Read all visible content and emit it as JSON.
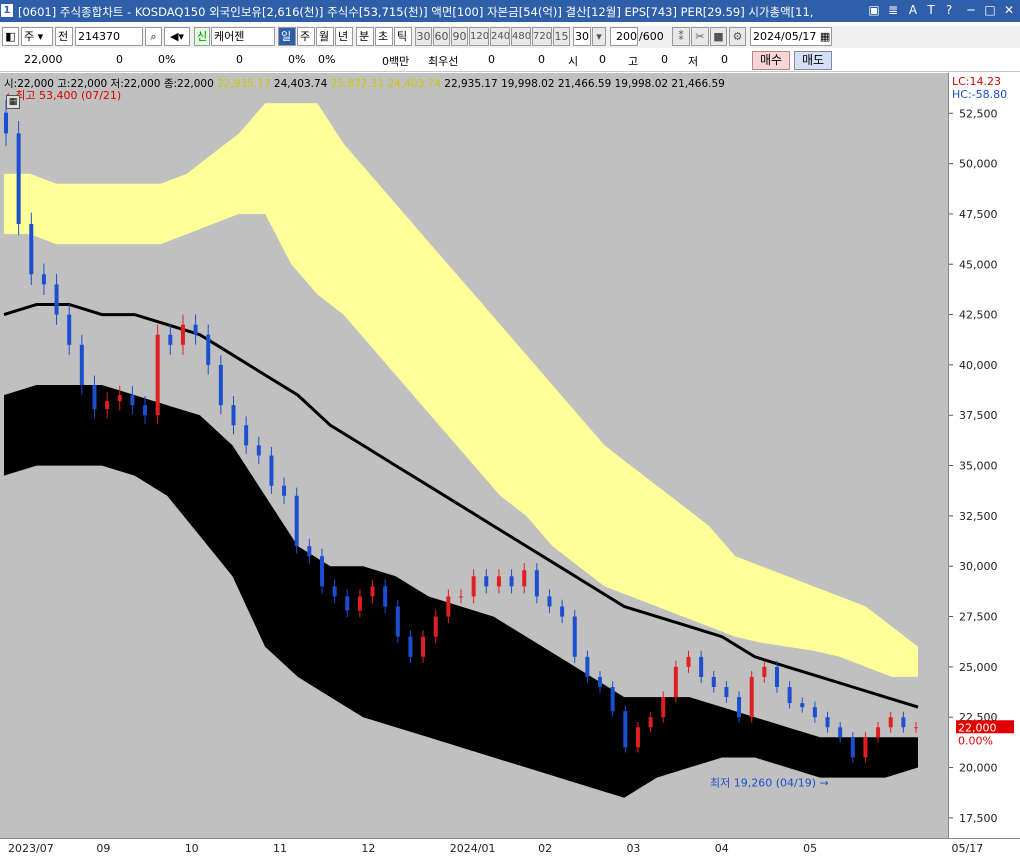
{
  "window": {
    "index_badge": "1",
    "title": "[0601] 주식종합차트 - KOSDAQ150 외국인보유[2,616(천)] 주식수[53,715(천)] 액면[100] 자본금[54(억)] 결산[12월] EPS[743] PER[29.59] 시가총액[11,"
  },
  "toolbar": {
    "period_selector": "주",
    "market_selector": "전",
    "stock_code": "214370",
    "stock_name": "케어젠",
    "new_badge": "신",
    "period_tabs": [
      "일",
      "주",
      "월",
      "년",
      "분",
      "초",
      "틱"
    ],
    "selected_period": "일",
    "interval_buttons": [
      "30",
      "60",
      "90",
      "120",
      "240",
      "480",
      "720",
      "15",
      "30"
    ],
    "count_value": "200",
    "count_total": "/600",
    "date": "2024/05/17"
  },
  "infobar": {
    "price": "22,000",
    "change": "0",
    "rate": "0%",
    "volume": "0",
    "vol_rate": "0%",
    "vol_rate2": "0%",
    "amount": "0백만",
    "priority_label": "최우선",
    "priority_value": "0",
    "v2": "0",
    "open_label": "시",
    "open_value": "0",
    "high_label": "고",
    "high_value": "0",
    "low_label": "저",
    "low_value": "0",
    "buy_label": "매수",
    "sell_label": "매도"
  },
  "legend": {
    "ohlc": "시:22,000 고:22,000 저:22,000 종:22,000",
    "cloud1_a": "22,935.17",
    "cloud1_b": "24,403.74",
    "cloud2_a": "25,872.31",
    "cloud2_b": "24,403.74",
    "lines": "22,935.17 19,998.02 21,466.59 19,998.02 21,466.59"
  },
  "indicators": {
    "lc": "LC:14.23",
    "hc": "HC:-58.80"
  },
  "annotations": {
    "high": "최고 53,400 (07/21)",
    "low": "최저 19,260 (04/19)"
  },
  "current_price_tag": {
    "price": "22,000",
    "rate": "0.00%"
  },
  "colors": {
    "up": "#e02020",
    "down": "#1c4fd0",
    "cloud_yellow": "#ffff99",
    "cloud_black": "#000000",
    "chart_bg": "#c0c0c0",
    "title_bg": "#2e5fa8"
  },
  "chart_data": {
    "type": "candlestick",
    "title": "",
    "y_axis": {
      "range": [
        16500,
        54500
      ],
      "ticks": [
        52500,
        50000,
        47500,
        45000,
        42500,
        40000,
        37500,
        35000,
        32500,
        30000,
        27500,
        25000,
        22500,
        20000,
        17500
      ],
      "tick_labels": [
        "52,500",
        "50,000",
        "47,500",
        "45,000",
        "42,500",
        "40,000",
        "37,500",
        "35,000",
        "32,500",
        "30,000",
        "27,500",
        "25,000",
        "22,500",
        "20,000",
        "17,500"
      ]
    },
    "x_axis": {
      "labels": [
        "2023/07",
        "09",
        "10",
        "11",
        "12",
        "2024/01",
        "02",
        "03",
        "04",
        "05",
        "05/17"
      ]
    },
    "series": [
      {
        "name": "price",
        "close": [
          51500,
          47000,
          44500,
          44000,
          42500,
          41000,
          39000,
          37800,
          38200,
          38500,
          38000,
          37500,
          41500,
          41000,
          42000,
          41500,
          40000,
          38000,
          37000,
          36000,
          35500,
          34000,
          33500,
          31000,
          30500,
          29000,
          28500,
          27800,
          28500,
          29000,
          28000,
          26500,
          25500,
          26500,
          27500,
          28500,
          28500,
          29500,
          29000,
          29500,
          29000,
          29800,
          28500,
          28000,
          27500,
          25500,
          24500,
          24000,
          22800,
          21000,
          22000,
          22500,
          23500,
          25000,
          25500,
          24500,
          24000,
          23500,
          22500,
          24500,
          25000,
          24000,
          23200,
          23000,
          22500,
          22000,
          21500,
          20500,
          21500,
          22000,
          22500,
          22000,
          22000
        ]
      }
    ],
    "upper_cloud": {
      "top": [
        49500,
        49500,
        49000,
        49000,
        49000,
        49000,
        49000,
        49500,
        50500,
        51500,
        53000,
        53000,
        53000,
        51000,
        49500,
        48000,
        46500,
        45000,
        43500,
        42000,
        40500,
        39000,
        37500,
        36000,
        35000,
        34000,
        33000,
        32000,
        30500,
        30000,
        29500,
        29000,
        28500,
        28000,
        27000,
        26000
      ],
      "bottom": [
        46500,
        46500,
        46000,
        46000,
        46000,
        46000,
        46000,
        46500,
        47000,
        47500,
        47500,
        45000,
        43500,
        42500,
        41000,
        39500,
        38000,
        36500,
        35000,
        33500,
        32500,
        31000,
        30000,
        29000,
        28500,
        28000,
        27500,
        27000,
        26500,
        26200,
        26000,
        25800,
        25500,
        25000,
        24500,
        24500
      ]
    },
    "lower_cloud": {
      "top": [
        38500,
        39000,
        39000,
        39000,
        38500,
        38000,
        37500,
        36000,
        33500,
        31000,
        30000,
        30000,
        29500,
        28500,
        28000,
        27500,
        26500,
        25500,
        24500,
        23500,
        23500,
        23500,
        23000,
        22500,
        22000,
        21500,
        21500,
        21500,
        21500
      ],
      "bottom": [
        34500,
        35000,
        35000,
        35000,
        34500,
        33500,
        31500,
        29500,
        26000,
        24500,
        23500,
        22500,
        22000,
        21500,
        21000,
        20500,
        20000,
        19500,
        19000,
        18500,
        19500,
        20000,
        20500,
        20500,
        20000,
        19500,
        19500,
        19500,
        20000
      ]
    },
    "base_line": [
      42500,
      43000,
      43000,
      42500,
      42500,
      42000,
      41500,
      40500,
      39500,
      38500,
      37000,
      36000,
      35000,
      34000,
      33000,
      32000,
      31000,
      30000,
      29000,
      28000,
      27500,
      27000,
      26500,
      25500,
      25000,
      24500,
      24000,
      23500,
      23000
    ]
  }
}
